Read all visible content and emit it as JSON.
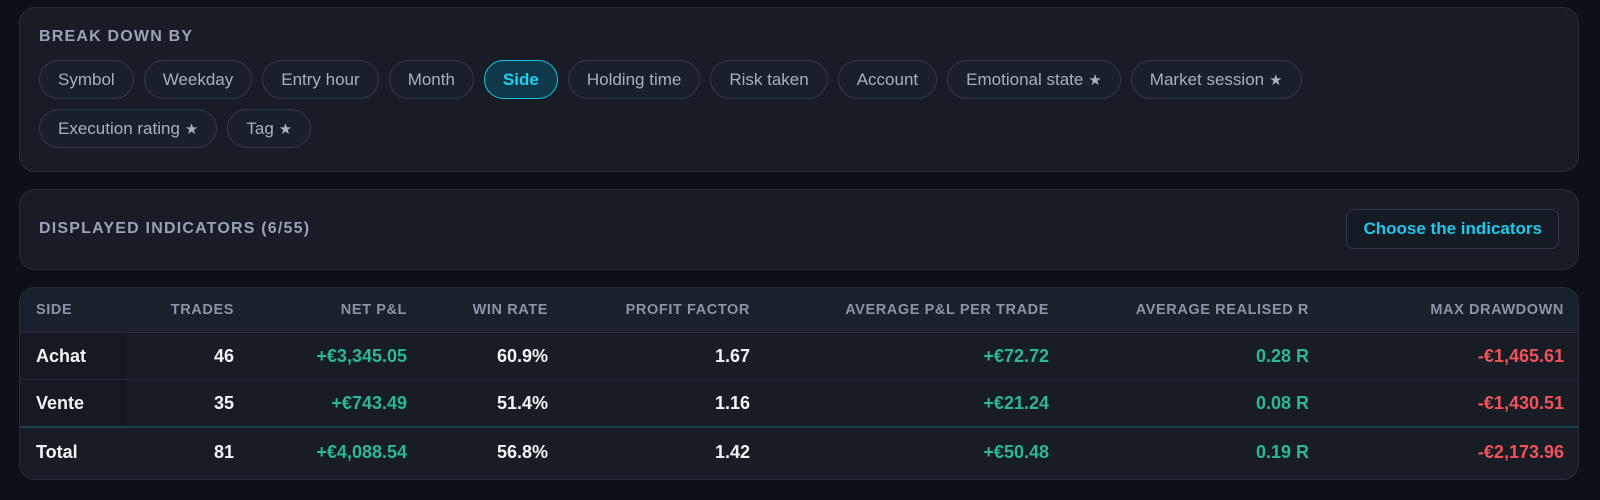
{
  "breakdown": {
    "title": "BREAK DOWN BY",
    "chips": [
      {
        "label": "Symbol",
        "star": false,
        "active": false
      },
      {
        "label": "Weekday",
        "star": false,
        "active": false
      },
      {
        "label": "Entry hour",
        "star": false,
        "active": false
      },
      {
        "label": "Month",
        "star": false,
        "active": false
      },
      {
        "label": "Side",
        "star": false,
        "active": true
      },
      {
        "label": "Holding time",
        "star": false,
        "active": false
      },
      {
        "label": "Risk taken",
        "star": false,
        "active": false
      },
      {
        "label": "Account",
        "star": false,
        "active": false
      },
      {
        "label": "Emotional state",
        "star": true,
        "active": false
      },
      {
        "label": "Market session",
        "star": true,
        "active": false
      },
      {
        "label": "Execution rating",
        "star": true,
        "active": false
      },
      {
        "label": "Tag",
        "star": true,
        "active": false
      }
    ],
    "star_glyph": "★"
  },
  "indicators": {
    "title": "DISPLAYED INDICATORS (6/55)",
    "choose_button": "Choose the indicators"
  },
  "table": {
    "headers": [
      "SIDE",
      "TRADES",
      "NET P&L",
      "WIN RATE",
      "PROFIT FACTOR",
      "AVERAGE P&L PER TRADE",
      "AVERAGE REALISED R",
      "MAX DRAWDOWN"
    ],
    "rows": [
      [
        "Achat",
        "46",
        "+€3,345.05",
        "60.9%",
        "1.67",
        "+€72.72",
        "0.28 R",
        "-€1,465.61"
      ],
      [
        "Vente",
        "35",
        "+€743.49",
        "51.4%",
        "1.16",
        "+€21.24",
        "0.08 R",
        "-€1,430.51"
      ]
    ],
    "total": [
      "Total",
      "81",
      "+€4,088.54",
      "56.8%",
      "1.42",
      "+€50.48",
      "0.19 R",
      "-€2,173.96"
    ]
  },
  "colors": {
    "accent": "#1fd0f2",
    "positive": "#2bb892",
    "negative": "#f0535a"
  }
}
